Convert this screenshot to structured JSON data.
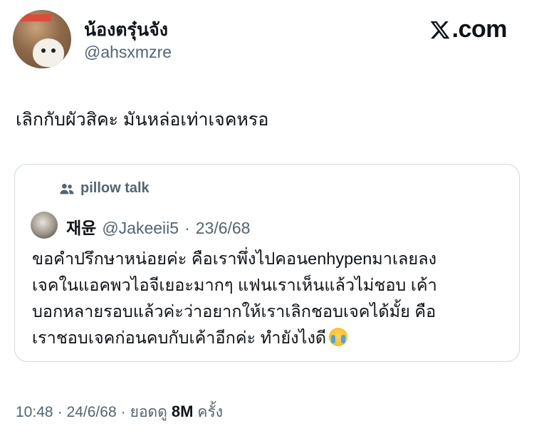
{
  "author": {
    "display_name": "น้องตรุ๋นจัง",
    "handle": "@ahsxmzre"
  },
  "brand": {
    "logo_text": ".com"
  },
  "tweet": {
    "text": "เลิกกับผัวสิคะ มันหล่อเท่าเจคหรอ"
  },
  "quoted": {
    "community": "pillow talk",
    "name": "재윤",
    "handle": "@Jakeeii5",
    "separator": "·",
    "date": "23/6/68",
    "lines": [
      "ขอคำปรึกษาหน่อยค่ะ คือเราพึ่งไปคอนenhypenมาเลยลง",
      "เจคในแอคพวไอจีเยอะมากๆ แฟนเราเห็นแล้วไม่ชอบ เค้า",
      "บอกหลายรอบแล้วค่ะว่าอยากให้เราเลิกชอบเจคได้มั้ย คือ",
      "เราชอบเจคก่อนคบกับเค้าอีกค่ะ ทำยังไงดี"
    ],
    "emoji": "loudly-crying-face"
  },
  "footer": {
    "time": "10:48",
    "sep1": "·",
    "date": "24/6/68",
    "sep2": "·",
    "views_label": "ยอดดู",
    "views_count": "8M",
    "views_unit": "ครั้ง"
  }
}
